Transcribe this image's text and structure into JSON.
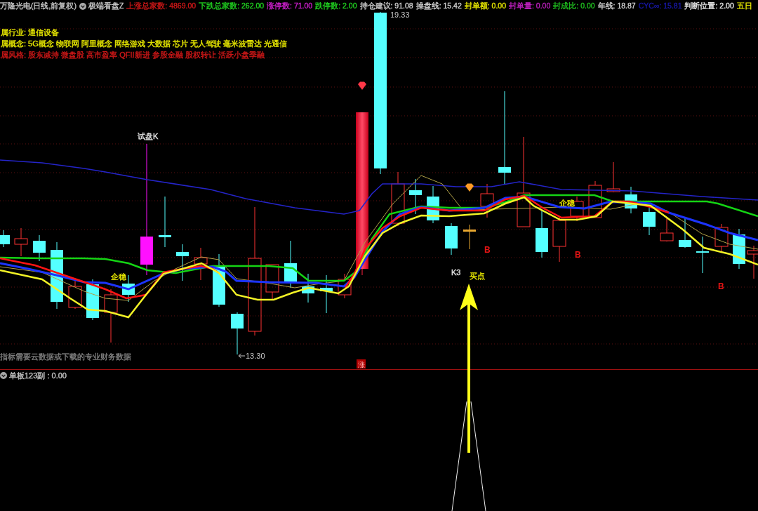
{
  "header": {
    "title": "万隆光电(日线,前复权)",
    "indicator": "极端看盘Z",
    "stats": [
      {
        "text": "上涨总家数: 4869.00",
        "color": "#d01818"
      },
      {
        "text": "下跌总家数: 262.00",
        "color": "#20d020"
      },
      {
        "text": "涨停数: 71.00",
        "color": "#d020d0"
      },
      {
        "text": "跌停数: 2.00",
        "color": "#20d020"
      },
      {
        "text": "持仓建议: 91.08",
        "color": "#d0d0d0"
      },
      {
        "text": "操盘线: 15.42",
        "color": "#d0d0d0"
      },
      {
        "text": "封单额: 0.00",
        "color": "#e8e800"
      },
      {
        "text": "封单量: 0.00",
        "color": "#c020c0"
      },
      {
        "text": "封成比: 0.00",
        "color": "#20c020"
      },
      {
        "text": "年线: 18.87",
        "color": "#d0d0d0"
      },
      {
        "text": "CYC∞: 15.81",
        "color": "#1818a8"
      },
      {
        "text": "判断位置: 2.00",
        "color": "#e8e8e8"
      },
      {
        "text": "五日",
        "color": "#e8e800"
      }
    ]
  },
  "info_lines": [
    {
      "text": "属行业: 通信设备",
      "color": "#e8e800"
    },
    {
      "text": "属概念: 5G概念 物联网 阿里概念 网络游戏 大数据 芯片 无人驾驶 毫米波雷达 光通信",
      "color": "#e8e800"
    },
    {
      "text": "属风格: 股东减持 微盘股 高市盈率 QFII新进 参股金融 股权转让 活跃小盘季融",
      "color": "#d01818"
    }
  ],
  "chart": {
    "price_labels": [
      "19.33",
      "13.30"
    ],
    "annotations": [
      {
        "text": "试盘K",
        "color": "#e0e0e0"
      },
      {
        "text": "企稳",
        "color": "#e8e800"
      },
      {
        "text": "K3",
        "color": "#e0e0e0"
      },
      {
        "text": "买点",
        "color": "#e8e800"
      },
      {
        "text": "企稳",
        "color": "#e8e800"
      }
    ],
    "signals": [
      "B",
      "B",
      "B"
    ],
    "tag": "涨"
  },
  "note": "指标需要云数据或下载的专业财务数据",
  "sub_panel": {
    "title": "单板123副 : 0.00"
  }
}
